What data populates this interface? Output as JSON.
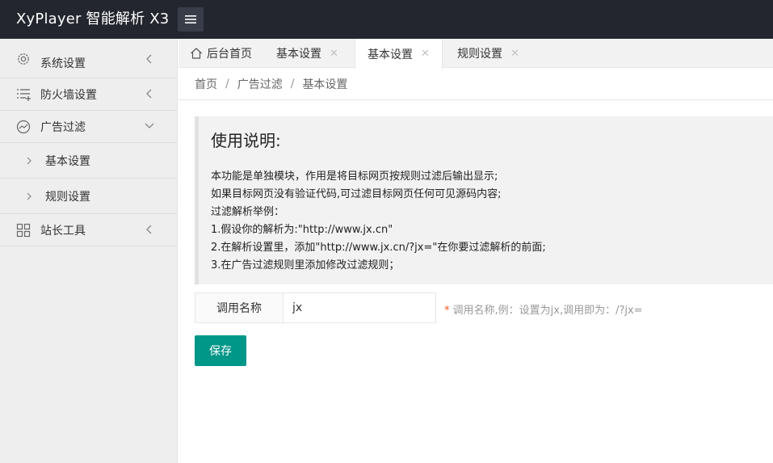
{
  "app": {
    "title": "XyPlayer 智能解析 X3"
  },
  "sidebar": {
    "items": [
      {
        "label": "系统设置",
        "icon": "gear-icon"
      },
      {
        "label": "防火墙设置",
        "icon": "list-icon"
      },
      {
        "label": "广告过滤",
        "icon": "chart-icon",
        "expanded": true,
        "children": [
          {
            "label": "基本设置"
          },
          {
            "label": "规则设置"
          }
        ]
      },
      {
        "label": "站长工具",
        "icon": "grid-icon"
      }
    ]
  },
  "tabs": [
    {
      "label": "后台首页",
      "icon": "home-icon",
      "closable": false
    },
    {
      "label": "基本设置",
      "closable": true
    },
    {
      "label": "基本设置",
      "closable": true,
      "active": true
    },
    {
      "label": "规则设置",
      "closable": true
    }
  ],
  "close_glyph": "✕",
  "breadcrumb": {
    "items": [
      "首页",
      "广告过滤",
      "基本设置"
    ],
    "separator": "/"
  },
  "notice": {
    "title": "使用说明:",
    "lines": [
      "本功能是单独模块，作用是将目标网页按规则过滤后输出显示;",
      "如果目标网页没有验证代码,可过滤目标网页任何可见源码内容;",
      "过滤解析举例：",
      "1.假设你的解析为:\"http://www.jx.cn\"",
      "2.在解析设置里，添加\"http://www.jx.cn/?jx=\"在你要过滤解析的前面;",
      "3.在广告过滤规则里添加修改过滤规则；"
    ]
  },
  "form": {
    "label": "调用名称",
    "value": "jx",
    "required_mark": "*",
    "hint": "调用名称,例：设置为jx,调用即为：/?jx="
  },
  "save_button": {
    "label": "保存"
  },
  "colors": {
    "header": "#23262e",
    "accent": "#009688",
    "required": "#ff5722"
  }
}
